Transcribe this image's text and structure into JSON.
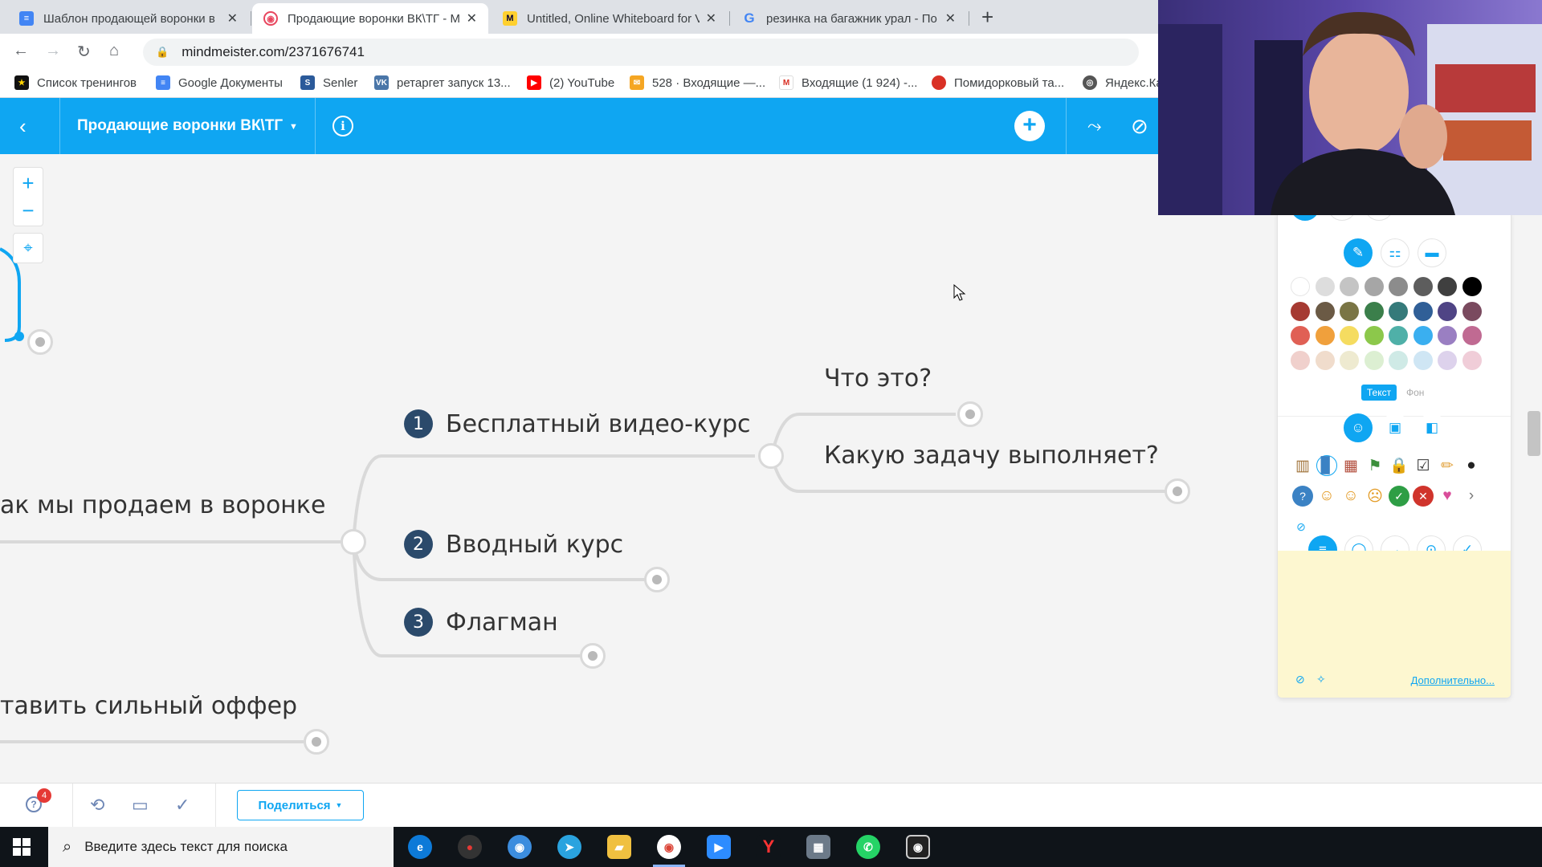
{
  "browser": {
    "tabs": [
      {
        "title": "Шаблон продающей воронки в",
        "icon": "google-docs-icon",
        "active": false
      },
      {
        "title": "Продающие воронки ВК\\ТГ - М",
        "icon": "mindmeister-icon",
        "active": true
      },
      {
        "title": "Untitled, Online Whiteboard for V",
        "icon": "miro-icon",
        "active": false
      },
      {
        "title": "резинка на багажник урал - По",
        "icon": "google-icon",
        "active": false
      }
    ],
    "new_tab": "+",
    "url": "mindmeister.com/2371676741",
    "bookmarks": [
      "Список тренингов",
      "Google Документы",
      "Senler",
      "ретаргет запуск 13...",
      "(2) YouTube",
      "528 · Входящие —...",
      "Входящие (1 924) -...",
      "Помидорковый та...",
      "Яндекс.Карты"
    ]
  },
  "app": {
    "map_title": "Продающие воронки ВК\\ТГ",
    "accent_color": "#0fa6f2"
  },
  "mindmap": {
    "root_partial": "ак мы продаем в воронке",
    "branch_partial": "тавить сильный оффер",
    "children": [
      {
        "number": "1",
        "label": "Бесплатный видео-курс"
      },
      {
        "number": "2",
        "label": "Вводный курс"
      },
      {
        "number": "3",
        "label": "Флагман"
      }
    ],
    "subchildren": [
      "Что это?",
      "Какую задачу выполняет?"
    ]
  },
  "panel": {
    "tab_text": "Текст",
    "tab_background": "Фон",
    "more_link": "Дополнительно...",
    "colors": [
      [
        "#ffffff",
        "#dddddd",
        "#c4c4c4",
        "#a6a6a6",
        "#8c8c8c",
        "#5d5d5d",
        "#3f3f3f",
        "#000000"
      ],
      [
        "#a63a32",
        "#6b5a45",
        "#7a7545",
        "#3b7f4b",
        "#357a7a",
        "#305f97",
        "#4f4485",
        "#7a4a5f"
      ],
      [
        "#e06055",
        "#f0a03c",
        "#f5dc60",
        "#8cc84b",
        "#4fb0a8",
        "#3aaff0",
        "#9a7fc2",
        "#c06a92"
      ],
      [
        "#f0d0cc",
        "#f0dccc",
        "#eeead0",
        "#dcefd2",
        "#cfeae6",
        "#cfe6f4",
        "#ddd2ec",
        "#f0cdd8"
      ]
    ]
  },
  "bottom": {
    "help_badge": "4",
    "share_label": "Поделиться"
  },
  "taskbar": {
    "search_placeholder": "Введите здесь текст для поиска"
  }
}
